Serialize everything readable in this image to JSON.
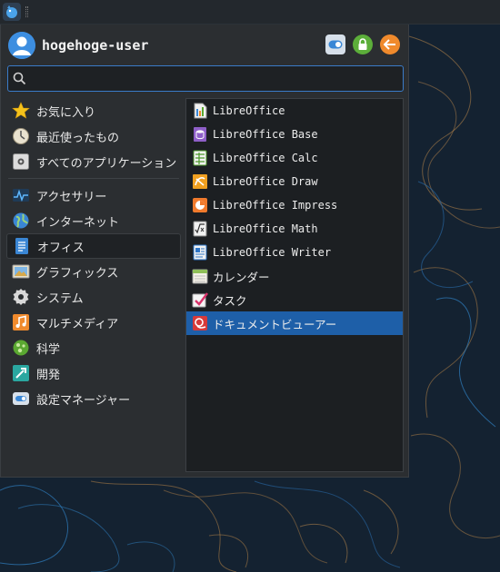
{
  "header": {
    "username": "hogehoge-user"
  },
  "search": {
    "value": "",
    "placeholder": ""
  },
  "categories": [
    {
      "label": "お気に入り",
      "icon": "star-icon"
    },
    {
      "label": "最近使ったもの",
      "icon": "clock-icon"
    },
    {
      "label": "すべてのアプリケーション",
      "icon": "all-apps-icon"
    },
    {
      "label": "アクセサリー",
      "icon": "accessories-icon"
    },
    {
      "label": "インターネット",
      "icon": "globe-icon"
    },
    {
      "label": "オフィス",
      "icon": "office-icon",
      "selected": true
    },
    {
      "label": "グラフィックス",
      "icon": "graphics-icon"
    },
    {
      "label": "システム",
      "icon": "gear-icon"
    },
    {
      "label": "マルチメディア",
      "icon": "music-icon"
    },
    {
      "label": "科学",
      "icon": "science-icon"
    },
    {
      "label": "開発",
      "icon": "development-icon"
    },
    {
      "label": "設定マネージャー",
      "icon": "settings-toggle-icon"
    }
  ],
  "apps": [
    {
      "label": "LibreOffice",
      "icon": "libreoffice-icon"
    },
    {
      "label": "LibreOffice Base",
      "icon": "libreoffice-base-icon"
    },
    {
      "label": "LibreOffice Calc",
      "icon": "libreoffice-calc-icon"
    },
    {
      "label": "LibreOffice Draw",
      "icon": "libreoffice-draw-icon"
    },
    {
      "label": "LibreOffice Impress",
      "icon": "libreoffice-impress-icon"
    },
    {
      "label": "LibreOffice Math",
      "icon": "libreoffice-math-icon"
    },
    {
      "label": "LibreOffice Writer",
      "icon": "libreoffice-writer-icon"
    },
    {
      "label": "カレンダー",
      "icon": "calendar-icon"
    },
    {
      "label": "タスク",
      "icon": "tasks-icon"
    },
    {
      "label": "ドキュメントビューアー",
      "icon": "document-viewer-icon",
      "selected": true
    }
  ],
  "colors": {
    "accent": "#1e5fa8",
    "search_border": "#3a7bc8",
    "desktop": "#14202c"
  }
}
